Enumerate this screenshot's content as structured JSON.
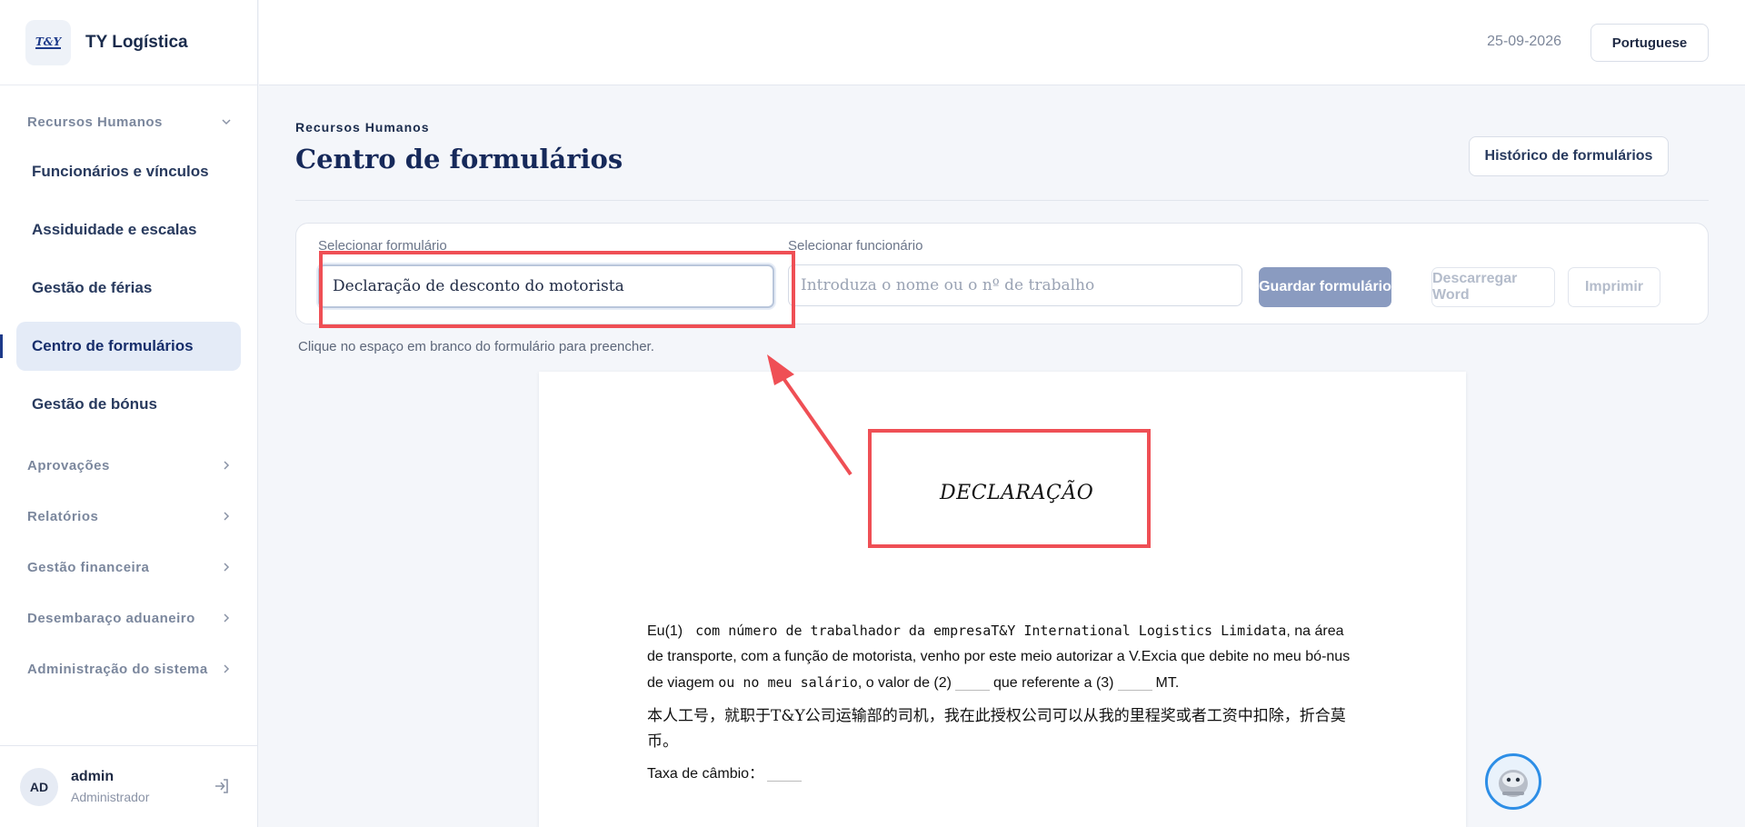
{
  "brand": {
    "logo_text": "T&Y",
    "name": "TY Logística"
  },
  "sidebar": {
    "section_title": "Recursos Humanos",
    "items": [
      {
        "label": "Funcionários e vínculos"
      },
      {
        "label": "Assiduidade e escalas"
      },
      {
        "label": "Gestão de férias"
      },
      {
        "label": "Centro de formulários",
        "active": true
      },
      {
        "label": "Gestão de bónus"
      }
    ],
    "groups": [
      {
        "label": "Aprovações"
      },
      {
        "label": "Relatórios"
      },
      {
        "label": "Gestão financeira"
      },
      {
        "label": "Desembaraço aduaneiro"
      },
      {
        "label": "Administração do sistema"
      }
    ]
  },
  "user": {
    "initials": "AD",
    "name": "admin",
    "role": "Administrador"
  },
  "topbar": {
    "date": "25-09-2026",
    "language": "Portuguese"
  },
  "header": {
    "eyebrow": "Recursos Humanos",
    "title": "Centro de formulários",
    "history_button": "Histórico de formulários"
  },
  "form": {
    "select_form_label": "Selecionar formulário",
    "select_form_value": "Declaração de desconto do motorista",
    "select_employee_label": "Selecionar funcionário",
    "select_employee_placeholder": "Introduza o nome ou o nº de trabalho",
    "save_button": "Guardar formulário",
    "download_button": "Descarregar Word",
    "print_button": "Imprimir",
    "hint": "Clique no espaço em branco do formulário para preencher."
  },
  "document": {
    "heading": "DECLARAÇÃO",
    "para1_a": "Eu(1)",
    "para1_b": "com número de trabalhador da empresa",
    "para1_company": "T&Y International Logistics Limidata",
    "para1_c": ", na área de transporte, com a função de motorista, venho por este meio autorizar a V.Excia que debite no meu bó-nus de viagem",
    "para1_d": "ou no meu salário",
    "para1_e": ", o valor de (2)",
    "para1_f": "que referente a (3)",
    "para1_g": "MT.",
    "para2_cn": "本人工号，就职于T&Y公司运输部的司机，我在此授权公司可以从我的里程奖或者工资中扣除，折合莫币。",
    "exchange_label": "Taxa de câmbio："
  },
  "colors": {
    "accent": "#1d3a8a",
    "annotation": "#ef4f55",
    "active_bg": "#e4ebf7"
  }
}
